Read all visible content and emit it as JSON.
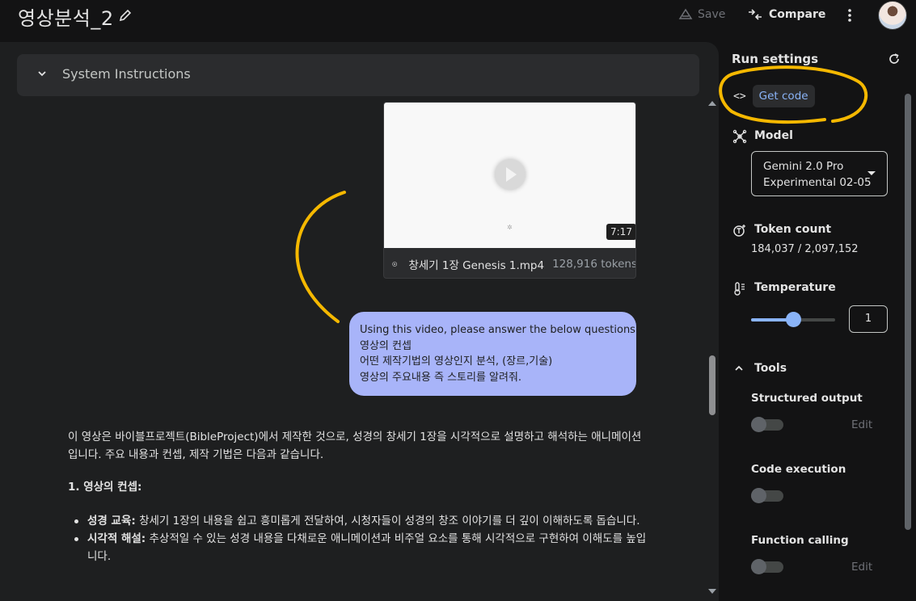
{
  "header": {
    "title": "영상분석_2",
    "save_label": "Save",
    "compare_label": "Compare"
  },
  "system_instructions": {
    "label": "System Instructions"
  },
  "video": {
    "duration": "7:17",
    "filename": "창세기 1장 Genesis 1.mp4",
    "tokens": "128,916 tokens"
  },
  "user_message": {
    "lines": [
      "Using this video, please answer the below questions",
      "영상의 컨셉",
      "어떤 제작기법의 영상인지 분석, (장르,기술)",
      "영상의 주요내용 즉 스토리를 알려줘."
    ]
  },
  "response": {
    "intro": "이 영상은 바이블프로젝트(BibleProject)에서 제작한 것으로, 성경의 창세기 1장을 시각적으로 설명하고 해석하는 애니메이션입니다. 주요 내용과 컨셉, 제작 기법은 다음과 같습니다.",
    "section1_title": "1. 영상의 컨셉:",
    "bullets": [
      {
        "bold": "성경 교육:",
        "text": " 창세기 1장의 내용을 쉽고 흥미롭게 전달하여, 시청자들이 성경의 창조 이야기를 더 깊이 이해하도록 돕습니다."
      },
      {
        "bold": "시각적 해설:",
        "text": " 추상적일 수 있는 성경 내용을 다채로운 애니메이션과 비주얼 요소를 통해 시각적으로 구현하여 이해도를 높입니다."
      }
    ]
  },
  "run_settings": {
    "title": "Run settings",
    "get_code_label": "Get code",
    "model_label": "Model",
    "model_value_line1": "Gemini 2.0 Pro",
    "model_value_line2": "Experimental 02-05",
    "token_count_label": "Token count",
    "token_count_value": "184,037 / 2,097,152",
    "temperature_label": "Temperature",
    "temperature_value": "1",
    "temperature_fraction": 0.5,
    "tools_label": "Tools",
    "tools": [
      {
        "name": "Structured output",
        "edit": "Edit",
        "enabled": false
      },
      {
        "name": "Code execution",
        "enabled": false
      },
      {
        "name": "Function calling",
        "edit": "Edit",
        "enabled": false
      }
    ]
  },
  "colors": {
    "accent": "#8ab4f8",
    "user_bubble": "#a8b4f9",
    "annotation": "#f5b800"
  }
}
